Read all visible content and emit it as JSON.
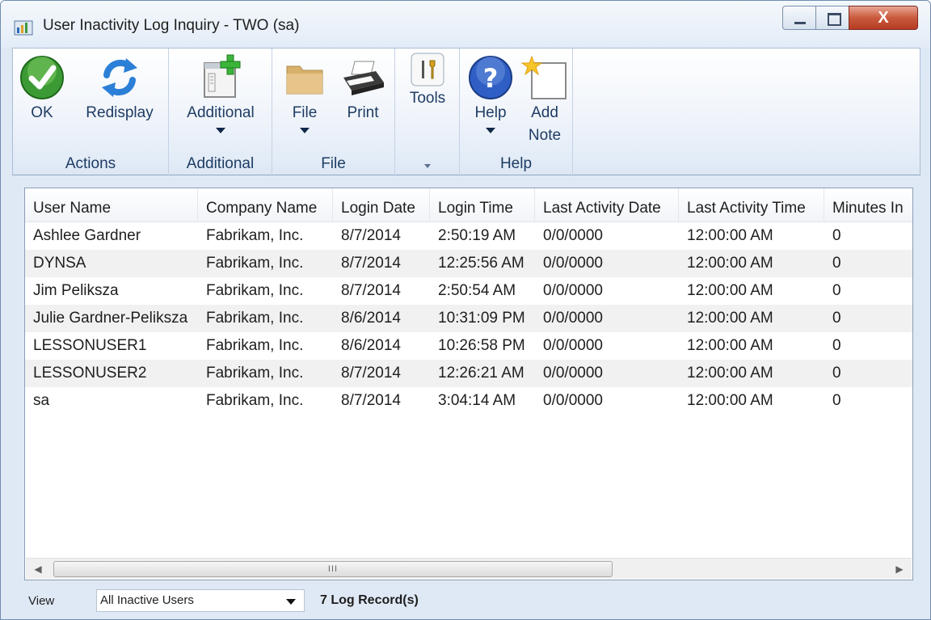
{
  "window": {
    "title": "User Inactivity Log Inquiry  -  TWO (sa)",
    "close_glyph": "X"
  },
  "ribbon": {
    "groups": [
      {
        "label": "Actions",
        "buttons": [
          {
            "label": "OK",
            "icon": "ok-check-icon"
          },
          {
            "label": "Redisplay",
            "icon": "refresh-icon"
          }
        ]
      },
      {
        "label": "Additional",
        "buttons": [
          {
            "label": "Additional",
            "icon": "additional-window-icon"
          }
        ]
      },
      {
        "label": "File",
        "buttons": [
          {
            "label": "File",
            "icon": "folder-icon"
          },
          {
            "label": "Print",
            "icon": "printer-icon"
          }
        ]
      },
      {
        "label": "",
        "buttons": [
          {
            "label": "Tools",
            "icon": "tools-icon"
          }
        ]
      },
      {
        "label": "Help",
        "buttons": [
          {
            "label": "Help",
            "icon": "help-icon"
          },
          {
            "label_line1": "Add",
            "label_line2": "Note",
            "icon": "add-note-icon"
          }
        ]
      }
    ]
  },
  "grid": {
    "columns": [
      "User Name",
      "Company Name",
      "Login Date",
      "Login Time",
      "Last Activity Date",
      "Last Activity Time",
      "Minutes In"
    ],
    "rows": [
      [
        "Ashlee Gardner",
        "Fabrikam, Inc.",
        "8/7/2014",
        "2:50:19 AM",
        "0/0/0000",
        "12:00:00 AM",
        "0"
      ],
      [
        "DYNSA",
        "Fabrikam, Inc.",
        "8/7/2014",
        "12:25:56 AM",
        "0/0/0000",
        "12:00:00 AM",
        "0"
      ],
      [
        "Jim Peliksza",
        "Fabrikam, Inc.",
        "8/7/2014",
        "2:50:54 AM",
        "0/0/0000",
        "12:00:00 AM",
        "0"
      ],
      [
        "Julie Gardner-Peliksza",
        "Fabrikam, Inc.",
        "8/6/2014",
        "10:31:09 PM",
        "0/0/0000",
        "12:00:00 AM",
        "0"
      ],
      [
        "LESSONUSER1",
        "Fabrikam, Inc.",
        "8/6/2014",
        "10:26:58 PM",
        "0/0/0000",
        "12:00:00 AM",
        "0"
      ],
      [
        "LESSONUSER2",
        "Fabrikam, Inc.",
        "8/7/2014",
        "12:26:21 AM",
        "0/0/0000",
        "12:00:00 AM",
        "0"
      ],
      [
        "sa",
        "Fabrikam, Inc.",
        "8/7/2014",
        "3:04:14 AM",
        "0/0/0000",
        "12:00:00 AM",
        "0"
      ]
    ],
    "scroll_thumb_grip": "III"
  },
  "statusbar": {
    "view_label": "View",
    "view_value": "All Inactive Users",
    "record_count": "7 Log Record(s)"
  }
}
